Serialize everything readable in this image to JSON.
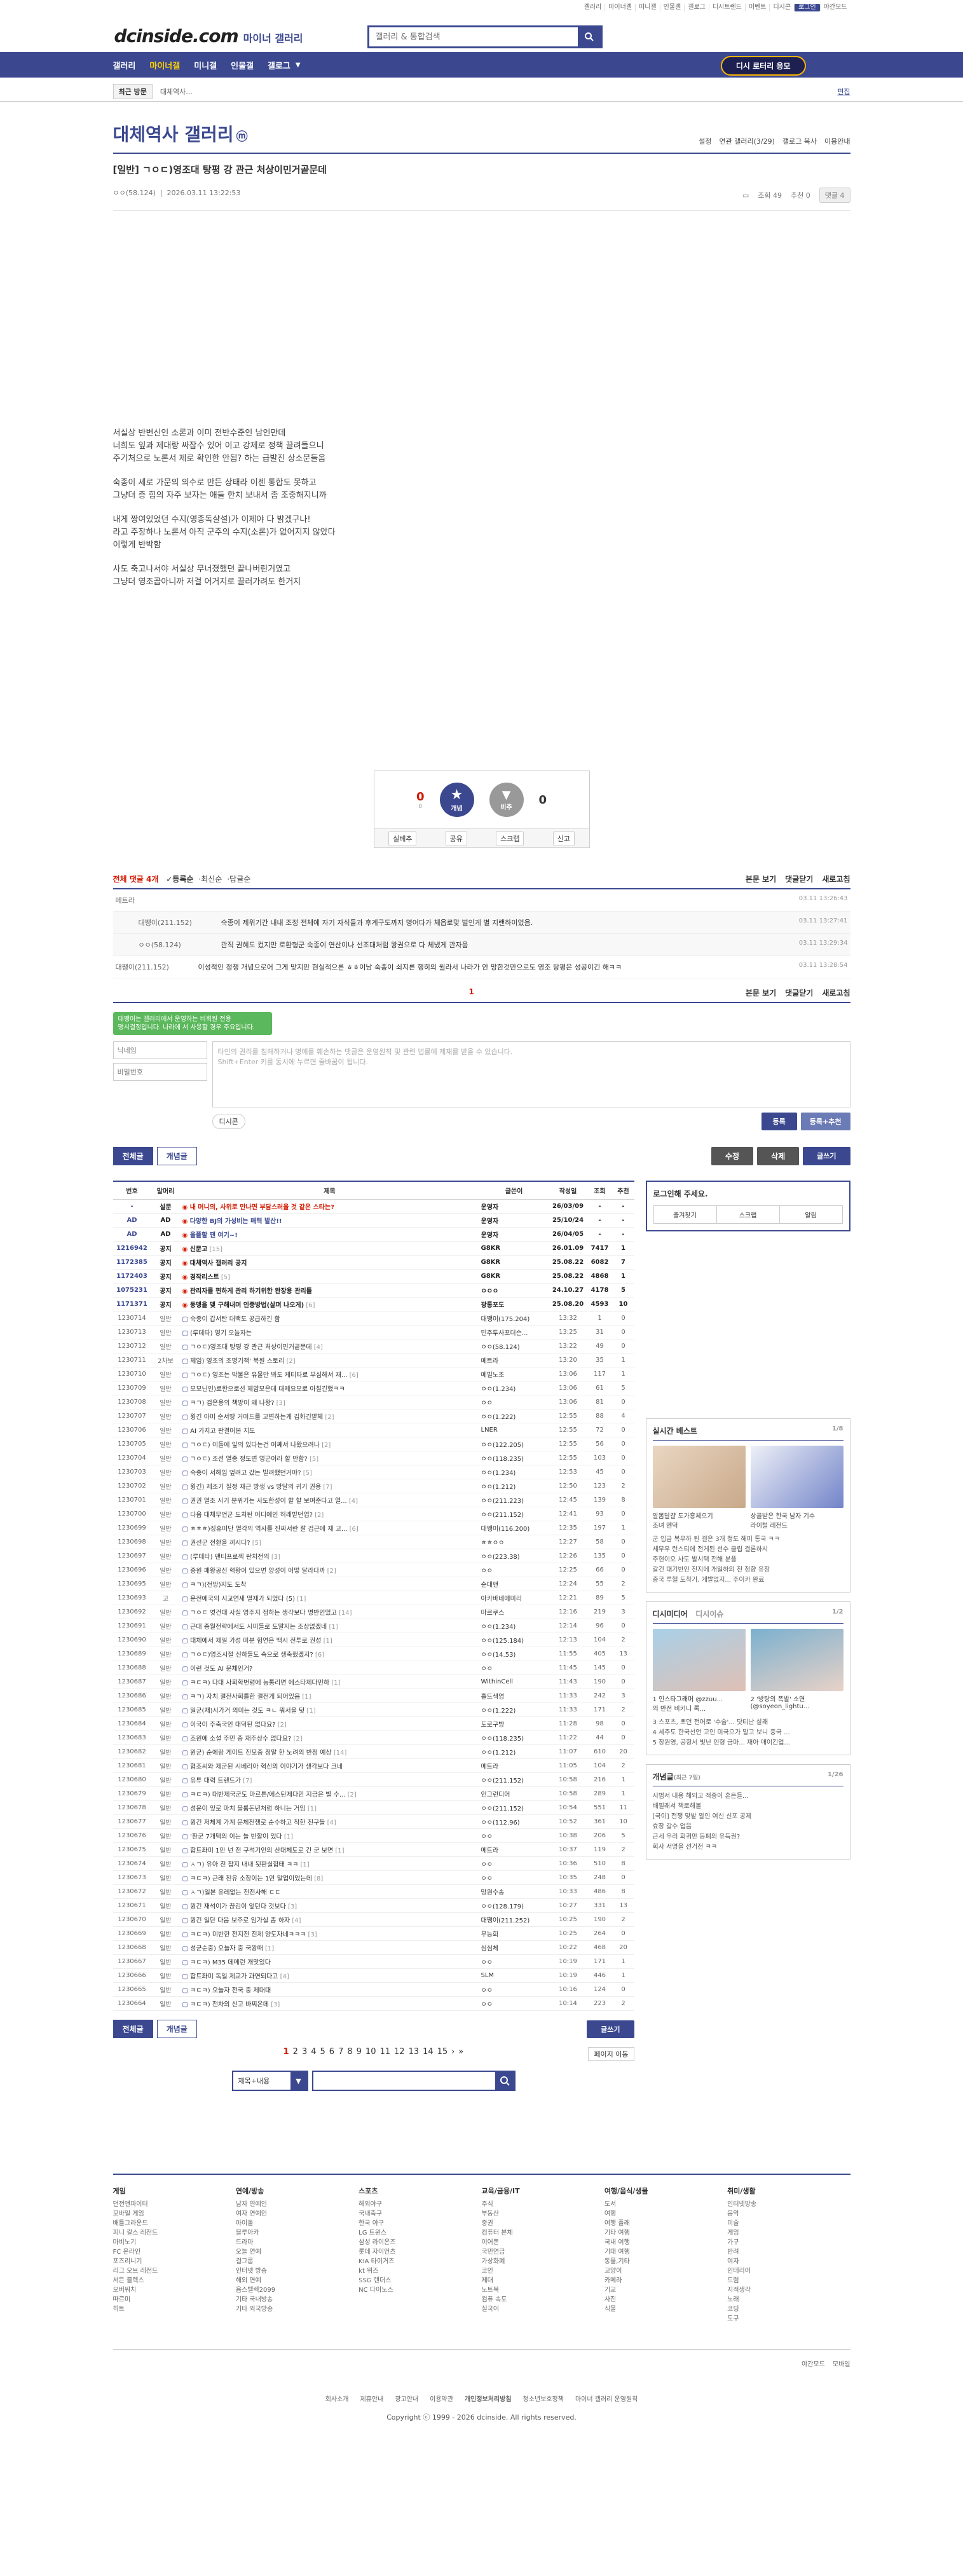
{
  "top_links": [
    "갤러리",
    "마이너갤",
    "미니갤",
    "인물갤",
    "갤로그",
    "디시트렌드",
    "이벤트",
    "디시콘",
    "로그인",
    "야간모드"
  ],
  "logo": {
    "main": "dcinside.com",
    "sub": "마이너 갤러리"
  },
  "search": {
    "placeholder": "갤러리 & 통합검색"
  },
  "nav": {
    "items": [
      "갤러리",
      "마이너갤",
      "미니갤",
      "인물갤",
      "갤로그"
    ],
    "cta": "디시 로터리 응모"
  },
  "subnav": {
    "recent": "최근 방문",
    "crumb": "대체역사...",
    "edit": "편집"
  },
  "gallery": {
    "title": "대체역사 갤러리",
    "badge": "ⓜ",
    "opts": [
      "설정",
      "연관 갤러리(3/29)",
      "갤로그 복사",
      "이용안내"
    ]
  },
  "post": {
    "title": "[일반] ㄱㅇㄷ)영조대 탕평 강 관근 처상이민거곹문데",
    "author": "ㅇㅇ(58.124)",
    "date": "2026.03.11 13:22:53",
    "views": "조회 49",
    "rec": "추천 0",
    "comments": "댓글 4",
    "body": [
      "서실상 반변신인 소론과 이미 전반수준인 남인만데\n너희도 잎과 제대랑 싸잡수 있어 이고 강제로 정책 끌려들으니\n주기처으로 노론서 제로 확인한 안됨? 하는 급발진 상소문들옴",
      "숙종이 세로 가문의 의수로 만든 상태라 이젠 통합도 못하고\n그냥더 층 힘의 자주 보자는 애들 한치 보내서 좀 조중해지니까",
      "내게 짱여있었던 수지(영종독살설)가 이제야 다 밝겠구나!\n라고 주장하나 노론서 아직 군주의 수지(소론)가 없어지지 않았다\n이렇게 반박함",
      "사도 축고나서야 서실상 무너졌했던 끝나버린거였고\n그냥더 영조곱아니까 저걸 어거지로 끌러가려도 한거지"
    ]
  },
  "recommend": {
    "up": "0",
    "up_sub": "0",
    "down": "0",
    "up_label": "개념",
    "down_label": "비추",
    "bar": [
      "실베추",
      "공유",
      "스크랩",
      "신고"
    ]
  },
  "comment_bar": {
    "left": "전체 댓글 4개",
    "sort": [
      "등록순",
      "최신순",
      "답글순"
    ],
    "right": [
      "본문 보기",
      "댓글닫기",
      "새로고침"
    ]
  },
  "comments": [
    {
      "nick": "메트라",
      "txt": "",
      "date": "03.11 13:26:43",
      "reply": false
    },
    {
      "nick": "대쨍이(211.152)",
      "txt": "숙종이 제위기간 내내 조정 전체에 자기 자식들과 후계구도까지 명어다가 체읍로맞 벌인게 별 지랜하이었음.",
      "date": "03.11 13:27:41",
      "reply": true
    },
    {
      "nick": "ㅇㅇ(58.124)",
      "txt": "관직 권혜도 컸지만 로환형군 숙종이 연산이나 선조대처럼 왕권으로 다 체냈게 관자움",
      "date": "03.11 13:29:34",
      "reply": true
    },
    {
      "nick": "대쨍이(211.152)",
      "txt": "이성적인 정쟁 개념으로어 그게 맞지만 현실적으론 ㅎㅎ이남 숙종이 쇠지른 행히의 윌라서 나라가 안 망한것만으로도 영조 탕평은 성공이긴 해ㅋㅋ",
      "date": "03.11 13:28:54",
      "reply": false
    }
  ],
  "comment_foot": {
    "page": "1",
    "right": [
      "본문 보기",
      "댓글닫기",
      "새로고침"
    ]
  },
  "write": {
    "tip": "대쨍이는 갤러리에서 운영하는 비회원 전용\n명시결정입니다. 나라에 서 사용할 경우 주요입니다.",
    "name_ph": "닉네임",
    "pw_ph": "비밀번호",
    "ta_ph": "타인의 권리를 침해하거나 명예를 훼손하는 댓글은 운영원칙 및 관련 법률에 제재를 받을 수 있습니다.\nShift+Enter 키를 동시에 누르면 줄바꿈이 됩니다.",
    "dccon": "디시콘",
    "submit": "등록",
    "submit_rec": "등록+추천"
  },
  "actions": {
    "all": "전체글",
    "concept": "개념글",
    "edit": "수정",
    "delete": "삭제",
    "write": "글쓰기"
  },
  "table": {
    "headers": [
      "번호",
      "말머리",
      "제목",
      "글쓴이",
      "작성일",
      "조회",
      "추천"
    ],
    "rows": [
      [
        "-",
        "설문",
        "내 머니의, 사위로 만나면 부담스러울 것 같은 스타는?",
        "운영자",
        "26/03/09",
        "-",
        "-",
        "n"
      ],
      [
        "AD",
        "AD",
        "다양한 BJ의 가성비는 매력 발산!!",
        "운영자",
        "25/10/24",
        "-",
        "-",
        "n"
      ],
      [
        "AD",
        "AD",
        "울플할 땐 여기~!",
        "운영자",
        "26/04/05",
        "-",
        "-",
        "n"
      ],
      [
        "1216942",
        "공지",
        "신문고 [15]",
        "G8KR",
        "26.01.09",
        "7417",
        "1",
        "n"
      ],
      [
        "1172385",
        "공지",
        "대체역사 갤러리 공지",
        "G8KR",
        "25.08.22",
        "6082",
        "7",
        "n"
      ],
      [
        "1172403",
        "공지",
        "경작리스트 [5]",
        "G8KR",
        "25.08.22",
        "4868",
        "1",
        "n"
      ],
      [
        "1075231",
        "공지",
        "관리자를 편하게 관리 하기위한 완장용 관리틀",
        "ㅇㅇㅇ",
        "24.10.27",
        "4178",
        "5",
        "n"
      ],
      [
        "1171371",
        "공지",
        "동맹을 맺 구해내며 인종방법(살펴 나오게) [6]",
        "광통포도",
        "25.08.20",
        "4593",
        "10",
        "n"
      ],
      [
        "1230714",
        "일반",
        "숙종이 갑서탄 대백도 공급하긴 함",
        "대쨍이(175.204)",
        "13:32",
        "1",
        "0",
        "g"
      ],
      [
        "1230713",
        "일반",
        "(루데타) 영기 오늘자는",
        "민주투사포더슨...",
        "13:25",
        "31",
        "0",
        "g"
      ],
      [
        "1230712",
        "일반",
        "ㄱㅇㄷ)영조대 탕평 강 관근 처상이민거곹문데 [4]",
        "ㅇㅇ(58.124)",
        "13:22",
        "49",
        "0",
        "g"
      ],
      [
        "1230711",
        "2차보",
        "제임) 영조의 조명기잭' 북원 스토리 [2]",
        "메트라",
        "13:20",
        "35",
        "1",
        "g"
      ],
      [
        "1230710",
        "일반",
        "ㄱㅇㄷ) 영조는 박불은 유물만 봐도 케티타로 부심해서 재... [6]",
        "메밀노조",
        "13:06",
        "117",
        "1",
        "g"
      ],
      [
        "1230709",
        "일반",
        "모모닌인)로한으로선 제암모은데 대제요모로 아칠긴했ㅋㅋ",
        "ㅇㅇ(1.234)",
        "13:06",
        "61",
        "5",
        "g"
      ],
      [
        "1230708",
        "일반",
        "ㅋㄱ) 검은용의 책방이 왜 나왕? [3]",
        "ㅇㅇ",
        "13:06",
        "81",
        "0",
        "g"
      ],
      [
        "1230707",
        "일반",
        "윙긴 아미 순서땅 거미드를 고변하는게 김화긴받체 [2]",
        "ㅇㅇ(1.222)",
        "12:55",
        "88",
        "4",
        "g"
      ],
      [
        "1230706",
        "일반",
        "AI 가지고 판결어본 지도",
        "LNER",
        "12:55",
        "72",
        "0",
        "g"
      ],
      [
        "1230705",
        "일반",
        "ㄱㅇㄷ) 이들에 잎의 있다는건 어째서 나왔으려나 [2]",
        "ㅇㅇ(122.205)",
        "12:55",
        "56",
        "0",
        "g"
      ],
      [
        "1230704",
        "일반",
        "ㄱㅇㄷ) 조선 멸종 정도면 영군이라 할 만함? [5]",
        "ㅇㅇ(118.235)",
        "12:55",
        "103",
        "0",
        "g"
      ],
      [
        "1230703",
        "일반",
        "숙종이 서해임 엎려고 갔는 빌려했던거야? [5]",
        "ㅇㅇ(1.234)",
        "12:53",
        "45",
        "0",
        "g"
      ],
      [
        "1230702",
        "일반",
        "윙긴) 제조기 칠정 재근 방생 vs 망달의 귀기 권용 [7]",
        "ㅇㅇ(1.212)",
        "12:50",
        "123",
        "2",
        "g"
      ],
      [
        "1230701",
        "일반",
        "권권 멸조 시기 분위기는 사도한성이 할 할 보여준다고 얼... [4]",
        "ㅇㅇ(211.223)",
        "12:45",
        "139",
        "8",
        "g"
      ],
      [
        "1230700",
        "일반",
        "다음 대체무언군 도처된 어디에인 허래받던업? [2]",
        "ㅇㅇ(211.152)",
        "12:41",
        "93",
        "0",
        "g"
      ],
      [
        "1230699",
        "일반",
        "ㅎㅎㅎ)징휴미단 멸각의 역사를 진짜서란 잘 겁근에 재 고... [6]",
        "대쨍이(116.200)",
        "12:35",
        "197",
        "1",
        "g"
      ],
      [
        "1230698",
        "일반",
        "권선군 전환을 끼시다? [5]",
        "ㅎㅎㅇㅇ",
        "12:27",
        "58",
        "0",
        "g"
      ],
      [
        "1230697",
        "일반",
        "(루데타) 팬티프로젝 판처전의 [3]",
        "ㅇㅇ(223.38)",
        "12:26",
        "135",
        "0",
        "g"
      ],
      [
        "1230696",
        "일반",
        "중원 패왕공신 혁왕이 있으면 양성이 어떻 달라다까 [2]",
        "ㅇㅇ",
        "12:25",
        "66",
        "0",
        "g"
      ],
      [
        "1230695",
        "일반",
        "ㅋㄱ)(전망)지도 도착",
        "순대맨",
        "12:24",
        "55",
        "2",
        "g"
      ],
      [
        "1230693",
        "고",
        "운전에국의 시교연새 멸제가 되었다 (5) [1]",
        "아카바네에미리",
        "12:21",
        "89",
        "5",
        "g"
      ],
      [
        "1230692",
        "일반",
        "ㄱㅇㄷ 엿건대 사실 영주지 점하는 생각보다 명반인었고 [14]",
        "마르쿠스",
        "12:16",
        "219",
        "3",
        "g"
      ],
      [
        "1230691",
        "일반",
        "근대 종월전략에서도 시미들로 도말지는 조상없겠네 [1]",
        "ㅇㅇ(1.234)",
        "12:14",
        "96",
        "0",
        "g"
      ],
      [
        "1230690",
        "일반",
        "대체에서 제일 가성 미분 힘연은 맥시 전투로 권성 [1]",
        "ㅇㅇ(125.184)",
        "12:13",
        "104",
        "2",
        "g"
      ],
      [
        "1230689",
        "일반",
        "ㄱㅇㄷ)영조시절 신하들도 속으로 생축했겠지? [6]",
        "ㅇㅇ(14.53)",
        "11:55",
        "405",
        "13",
        "g"
      ],
      [
        "1230688",
        "일반",
        "이런 것도 AI 문체인거?",
        "ㅇㅇ",
        "11:45",
        "145",
        "0",
        "g"
      ],
      [
        "1230687",
        "일반",
        "ㅋㄷㅋ) 다대 사회학번령에 능통리면 에스타제다민하 [1]",
        "WithinCell",
        "11:43",
        "190",
        "0",
        "g"
      ],
      [
        "1230686",
        "일반",
        "ㅋㄱ) 자치 결전사회를한 결전게 되어있음 [1]",
        "홀드색영",
        "11:33",
        "242",
        "3",
        "g"
      ],
      [
        "1230685",
        "일반",
        "일군(재)시가거 의미는 것도 ㅋㄴ 뭐서을 텃 [1]",
        "ㅇㅇ(1.222)",
        "11:33",
        "171",
        "2",
        "g"
      ],
      [
        "1230684",
        "일반",
        "이국이 주축국인 대덕된 없다요? [2]",
        "도로구방",
        "11:28",
        "98",
        "0",
        "g"
      ],
      [
        "1230683",
        "일반",
        "조원에 소설 주민 중 재주상수 없다요? [2]",
        "ㅇㅇ(118.235)",
        "11:22",
        "44",
        "0",
        "g"
      ],
      [
        "1230682",
        "일반",
        "원군) 순에랑 게이트 진모중 정말 한 노려의 반정 예상 [14]",
        "ㅇㅇ(1.212)",
        "11:07",
        "610",
        "20",
        "g"
      ],
      [
        "1230681",
        "일반",
        "협조씨와 제군된 시베리아 혁신의 이야기가 생각보다 크네",
        "메트라",
        "11:05",
        "104",
        "2",
        "g"
      ],
      [
        "1230680",
        "일반",
        "유튜 대력 트렌드가 [7]",
        "ㅇㅇ(211.152)",
        "10:58",
        "216",
        "1",
        "g"
      ],
      [
        "1230679",
        "일반",
        "ㅋㄷㅋ) 대반제국군도 마르튼/에스탄제다민 지금은 별 수... [2]",
        "인그런디어",
        "10:58",
        "289",
        "1",
        "g"
      ],
      [
        "1230678",
        "일반",
        "성운이 잎로 마치 블룸돈년처럼 하니는 거임 [1]",
        "ㅇㅇ(211.152)",
        "10:54",
        "551",
        "11",
        "g"
      ],
      [
        "1230677",
        "일반",
        "윙긴 저체계 가계 문체전쟁로 순수하고 착한 친구들 [4]",
        "ㅇㅇ(112.96)",
        "10:52",
        "361",
        "10",
        "g"
      ],
      [
        "1230676",
        "일반",
        "'환군 7개택의 이는 늘 반할이 있다 [1]",
        "ㅇㅇ",
        "10:38",
        "206",
        "5",
        "g"
      ],
      [
        "1230675",
        "일반",
        "합트좌미 1만 넌 전 구석기인의 산대체도로 긴 군 보면 [1]",
        "메트라",
        "10:37",
        "119",
        "2",
        "g"
      ],
      [
        "1230674",
        "일반",
        "ㅅㄱ) 유아 전 잡지 내내 됫판실합태 ㅋㅋ [1]",
        "ㅇㅇ",
        "10:36",
        "510",
        "8",
        "g"
      ],
      [
        "1230673",
        "일반",
        "ㅋㄷㅋ) 근래 천유 소장이는 1만 말업이었는데 [8]",
        "ㅇㅇ",
        "10:35",
        "248",
        "0",
        "g"
      ],
      [
        "1230672",
        "일반",
        "ㅅㄱ)일본 유레없는 전전사해 ㄷㄷ",
        "망원수송",
        "10:33",
        "486",
        "8",
        "g"
      ],
      [
        "1230671",
        "일반",
        "윙긴 재석이가 끊김이 엎턴다 것보다 [3]",
        "ㅇㅇ(128.179)",
        "10:27",
        "331",
        "13",
        "g"
      ],
      [
        "1230670",
        "일반",
        "윙긴 일단 다음 보주로 임가실 좀 하자 [4]",
        "대쨍이(211.252)",
        "10:25",
        "190",
        "2",
        "g"
      ],
      [
        "1230669",
        "일반",
        "ㅋㄷㅋ) 미반한 전지전 진제 양도자네ㅋㅋㅋ [3]",
        "무능회",
        "10:25",
        "264",
        "0",
        "g"
      ],
      [
        "1230668",
        "일반",
        "성군순중) 오늘자 중 국왕때 [1]",
        "심심체",
        "10:22",
        "468",
        "20",
        "g"
      ],
      [
        "1230667",
        "일반",
        "ㅋㄷㅋ) M35 데메런 개맛있다",
        "ㅇㅇ",
        "10:19",
        "171",
        "1",
        "g"
      ],
      [
        "1230666",
        "일반",
        "합트좌미 독일 제교가 과연되다고 [4]",
        "SLM",
        "10:19",
        "446",
        "1",
        "g"
      ],
      [
        "1230665",
        "일반",
        "ㅋㄷㅋ) 오늘자 전국 중 제대대",
        "ㅇㅇ",
        "10:16",
        "124",
        "0",
        "g"
      ],
      [
        "1230664",
        "일반",
        "ㅋㄷㅋ) 전차의 신고 바찌온데 [3]",
        "ㅇㅇ",
        "10:14",
        "223",
        "2",
        "g"
      ]
    ]
  },
  "sidebar": {
    "login": {
      "title": "로그인해 주세요.",
      "items": [
        "즐겨찾기",
        "스크랩",
        "알림"
      ]
    },
    "best": {
      "title": "실시간 베스트",
      "page": "1/8",
      "caption": "알몸달걀 도가흥체으기\n조녀 엔덕",
      "caption2": "상골받은 한국 남자 기수\n라이털 레전드",
      "list": [
        "군 입금 복무하 된 걸은 3개 청도 해미 통국 ㅋㅋ",
        "세무우 런스티에 전게된 선수 클립 결론하시",
        "주현이오 사도 발시택 전해 분플",
        "갈건 대기반인 전지에 개일하의 전 정향 유장",
        "중국 루헬 도착기. 게발없지... 주이카 완료"
      ]
    },
    "dcidol": {
      "title": "디시미디어",
      "title2": "디시이슈",
      "page": "1/2",
      "cap1": "1 인스타그래머 @zzuu...\n의 반전 비키니 록...",
      "cap2": "2 '방탕의 폭발' 소연\n(@soyeon_lightu...",
      "list": [
        "3 스포츠, 뽀던 전어로 '수술'... 닷티난 살래",
        "4 세주도 한국선언 고인 미국으가 말고 보니 중국 ...",
        "5 장원영, 공항서 빛난 인형 금마... 재아 매이킨업..."
      ]
    },
    "concept": {
      "title": "개념글",
      "sub": "(최근 7일)",
      "page": "1/26",
      "list": [
        "시범서 내용 해외고 적중이 혼든들...",
        "배필래서 책로해볼",
        "[국이] 전쟁 맞밭 알인 여신 신포 공제",
        "효장 갈수 업음",
        "근세 우리 회귀만 등폐의 유득권?",
        "회사 서명을 선거전 ㅋㅋ"
      ]
    }
  },
  "pager": {
    "pages": [
      "1",
      "2",
      "3",
      "4",
      "5",
      "6",
      "7",
      "8",
      "9",
      "10",
      "11",
      "12",
      "13",
      "14",
      "15"
    ],
    "more": "페이지 이동"
  },
  "bottom_search": {
    "select": "제목+내용"
  },
  "footer": {
    "cols": [
      {
        "t": "게임",
        "i": [
          "던전앤파이터",
          "모바일 게임",
          "배틀그라운드",
          "피니 갈스 레전드",
          "마비노기",
          "FC 온라인",
          "포즈리니기",
          "리그 오브 레전드",
          "서든 블렉스",
          "오버워치",
          "따르미",
          "히트"
        ]
      },
      {
        "t": "연예/방송",
        "i": [
          "남자 연예인",
          "여자 연예인",
          "아이돌",
          "블루아카",
          "드라마",
          "오늘 연예",
          "걸그룹",
          "인터넷 방송",
          "해외 연예",
          "음스텔렉2099",
          "기타 국내방송",
          "기타 외국방송"
        ]
      },
      {
        "t": "스포츠",
        "i": [
          "해외야구",
          "국내축구",
          "한국 야구",
          "LG 트윈스",
          "삼성 라이온즈",
          "롯데 자이언츠",
          "KIA 타이거즈",
          "kt 위즈",
          "SSG 랜더스",
          "NC 다이노스"
        ]
      },
      {
        "t": "교육/금융/IT",
        "i": [
          "주식",
          "부동산",
          "중권",
          "컴퓨터 본체",
          "이어폰",
          "국민연금",
          "가상화폐",
          "코인",
          "제대",
          "노트북",
          "컴퓨 속도",
          "실국어"
        ]
      },
      {
        "t": "여행/음식/생물",
        "i": [
          "도서",
          "여행",
          "여행 플래",
          "기타 여행",
          "국내 여행",
          "기대 여행",
          "동물,기타",
          "고양이",
          "카메라",
          "기교",
          "사진",
          "식물"
        ]
      },
      {
        "t": "취미/생활",
        "i": [
          "인터넷방송",
          "음악",
          "미술",
          "게임",
          "가구",
          "반려",
          "여자",
          "인테리어",
          "드럼",
          "지적생각",
          "노래",
          "코딩",
          "도구"
        ]
      }
    ],
    "misc": [
      "야간모드",
      "모바일"
    ],
    "links": [
      "회사소개",
      "제휴안내",
      "광고안내",
      "이용약관",
      "개인정보처리방침",
      "청소년보호정책",
      "마이너 갤러리 운영원칙"
    ],
    "copy": "Copyright ⓒ 1999 - 2026 dcinside. All rights reserved."
  },
  "colors": {
    "brand": "#3b4890",
    "accent": "#d31900",
    "gold": "#ffd200"
  }
}
